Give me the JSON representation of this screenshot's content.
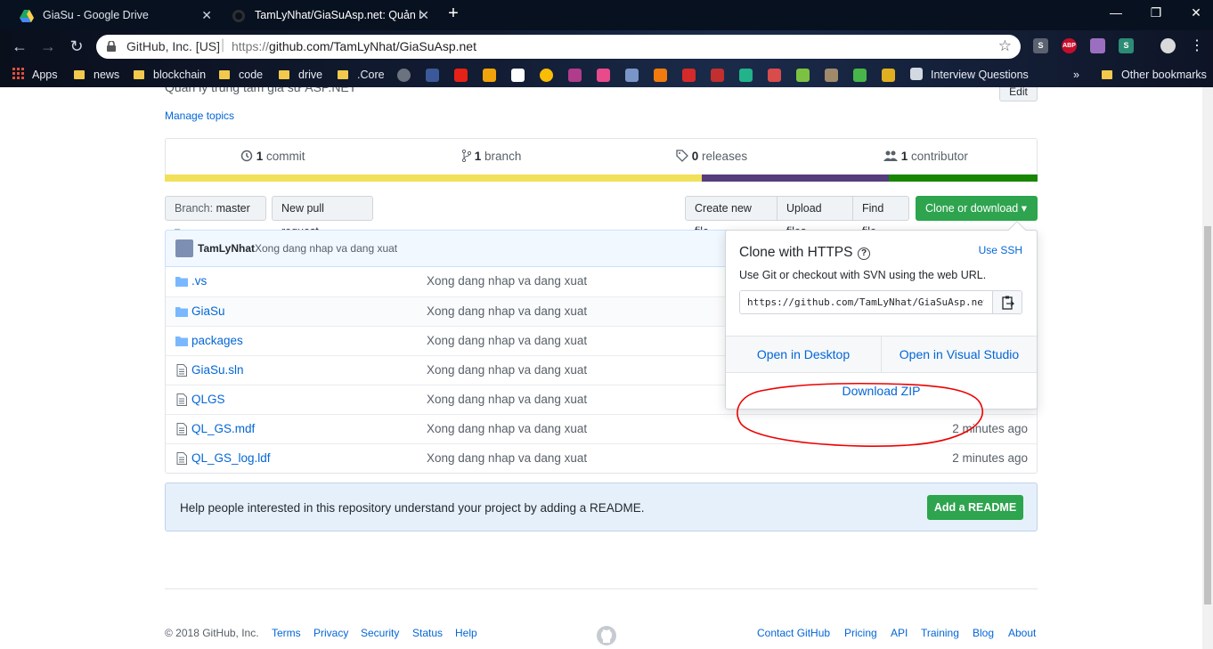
{
  "browser": {
    "tabs": [
      {
        "title": "GiaSu - Google Drive",
        "close": "✕"
      },
      {
        "title": "TamLyNhat/GiaSuAsp.net: Quản l",
        "close": "✕"
      }
    ],
    "new_tab": "+",
    "window_controls": {
      "minimize": "—",
      "restore": "❐",
      "close": "✕"
    },
    "nav": {
      "back": "←",
      "forward": "→",
      "reload": "↻"
    },
    "address": {
      "org": "GitHub, Inc. [US]",
      "separator": "|",
      "url_prefix": "https://",
      "url_main": "github.com/TamLyNhat/GiaSuAsp.net",
      "star": "☆"
    },
    "extensions": [
      {
        "label": "S",
        "color": "#5b6270"
      },
      {
        "label": "ABP",
        "color": "#c70d2c"
      },
      {
        "label": "",
        "color": "#9b6fc0"
      },
      {
        "label": "S",
        "color": "#2c8c74"
      },
      {
        "label": "",
        "color": "#d9d9d9"
      }
    ],
    "bookmarks": {
      "apps": "Apps",
      "folders": [
        "news",
        "blockchain",
        "code",
        "drive",
        ".Core"
      ],
      "interview": "Interview Questions",
      "more": "»",
      "other": "Other bookmarks"
    }
  },
  "repo": {
    "description": "Quản lý trung tâm gia sư ASP.NET",
    "edit_label": "Edit",
    "manage_topics": "Manage topics",
    "stats": {
      "commits": {
        "count": "1",
        "label": "commit"
      },
      "branches": {
        "count": "1",
        "label": "branch"
      },
      "releases": {
        "count": "0",
        "label": "releases"
      },
      "contributors": {
        "count": "1",
        "label": "contributor"
      }
    },
    "language_colors": [
      "#f1e05a",
      "#563d7c",
      "#178600"
    ],
    "language_shares": [
      0.615,
      0.215,
      0.17
    ],
    "branch": {
      "prefix": "Branch:",
      "name": "master",
      "caret": "▾"
    },
    "new_pull_request": "New pull request",
    "create_new_file": "Create new file",
    "upload_files": "Upload files",
    "find_file": "Find file",
    "clone_or_download": "Clone or download ▾",
    "latest_commit": {
      "author": "TamLyNhat",
      "message": "Xong dang nhap va dang xuat"
    },
    "files": [
      {
        "type": "dir",
        "name": ".vs",
        "message": "Xong dang nhap va dang xuat",
        "age": ""
      },
      {
        "type": "dir",
        "name": "GiaSu",
        "message": "Xong dang nhap va dang xuat",
        "age": ""
      },
      {
        "type": "dir",
        "name": "packages",
        "message": "Xong dang nhap va dang xuat",
        "age": ""
      },
      {
        "type": "file",
        "name": "GiaSu.sln",
        "message": "Xong dang nhap va dang xuat",
        "age": ""
      },
      {
        "type": "file",
        "name": "QLGS",
        "message": "Xong dang nhap va dang xuat",
        "age": ""
      },
      {
        "type": "file",
        "name": "QL_GS.mdf",
        "message": "Xong dang nhap va dang xuat",
        "age": "2 minutes ago"
      },
      {
        "type": "file",
        "name": "QL_GS_log.ldf",
        "message": "Xong dang nhap va dang xuat",
        "age": "2 minutes ago"
      }
    ],
    "readme": {
      "text": "Help people interested in this repository understand your project by adding a README.",
      "button": "Add a README"
    }
  },
  "clone_popup": {
    "title": "Clone with HTTPS",
    "help": "?",
    "use_ssh": "Use SSH",
    "subtitle": "Use Git or checkout with SVN using the web URL.",
    "url": "https://github.com/TamLyNhat/GiaSuAsp.net.git",
    "open_desktop": "Open in Desktop",
    "open_vs": "Open in Visual Studio",
    "download_zip": "Download ZIP"
  },
  "footer": {
    "copyright": "© 2018 GitHub, Inc.",
    "left_links": [
      "Terms",
      "Privacy",
      "Security",
      "Status",
      "Help"
    ],
    "right_links": [
      "Contact GitHub",
      "Pricing",
      "API",
      "Training",
      "Blog",
      "About"
    ]
  }
}
